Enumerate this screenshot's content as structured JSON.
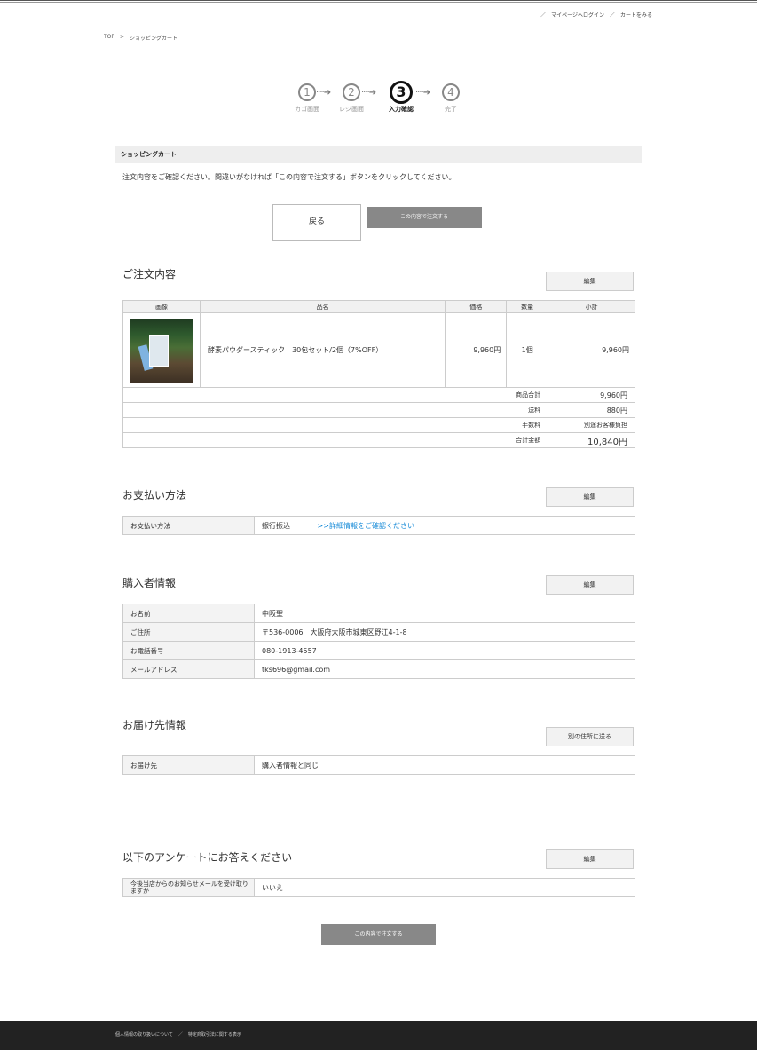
{
  "header": {
    "mypage_login": "マイページへログイン",
    "view_cart": "カートをみる",
    "sep": "／"
  },
  "breadcrumb": {
    "top": "TOP",
    "sep": ">",
    "current": "ショッピングカート"
  },
  "steps": [
    {
      "num": "1",
      "label": "カゴ画面"
    },
    {
      "num": "2",
      "label": "レジ画面"
    },
    {
      "num": "3",
      "label": "入力確認"
    },
    {
      "num": "4",
      "label": "完了"
    }
  ],
  "steps_arrow": "····➔",
  "cart_bar": "ショッピングカート",
  "notice": "注文内容をご確認ください。問違いがなければ「この内容で注文する」ボタンをクリックしてください。",
  "buttons": {
    "back": "戻る",
    "order": "この内容で注文する",
    "edit": "編集",
    "send_other": "別の住所に送る"
  },
  "order": {
    "title": "ご注文内容",
    "headers": {
      "image": "画像",
      "name": "品名",
      "price": "価格",
      "qty": "数量",
      "subtotal": "小計"
    },
    "item": {
      "name": "酵素パウダースティック　30包セット/2個（7%OFF）",
      "price": "9,960円",
      "qty": "1個",
      "subtotal": "9,960円"
    },
    "summary": [
      {
        "label": "商品合計",
        "value": "9,960円"
      },
      {
        "label": "送料",
        "value": "880円"
      },
      {
        "label": "手数料",
        "value": "別途お客様負担"
      },
      {
        "label": "合計金額",
        "value": "10,840円"
      }
    ]
  },
  "payment": {
    "title": "お支払い方法",
    "key": "お支払い方法",
    "value": "銀行振込",
    "link": ">>詳細情報をご確認ください"
  },
  "buyer": {
    "title": "購入者情報",
    "rows": [
      {
        "k": "お名前",
        "v": "中阪聖"
      },
      {
        "k": "ご住所",
        "v": "〒536-0006　大阪府大阪市城東区野江4-1-8"
      },
      {
        "k": "お電話番号",
        "v": "080-1913-4557"
      },
      {
        "k": "メールアドレス",
        "v": "tks696@gmail.com"
      }
    ]
  },
  "delivery": {
    "title": "お届け先情報",
    "key": "お届け先",
    "value": "購入者情報と同じ"
  },
  "survey": {
    "title": "以下のアンケートにお答えください",
    "key": "今後当店からのお知らせメールを受け取りますか",
    "value": "いいえ"
  },
  "footer": {
    "privacy": "個人情報の取り扱いについて",
    "sep": "／",
    "law": "特定商取引法に関する表示"
  }
}
